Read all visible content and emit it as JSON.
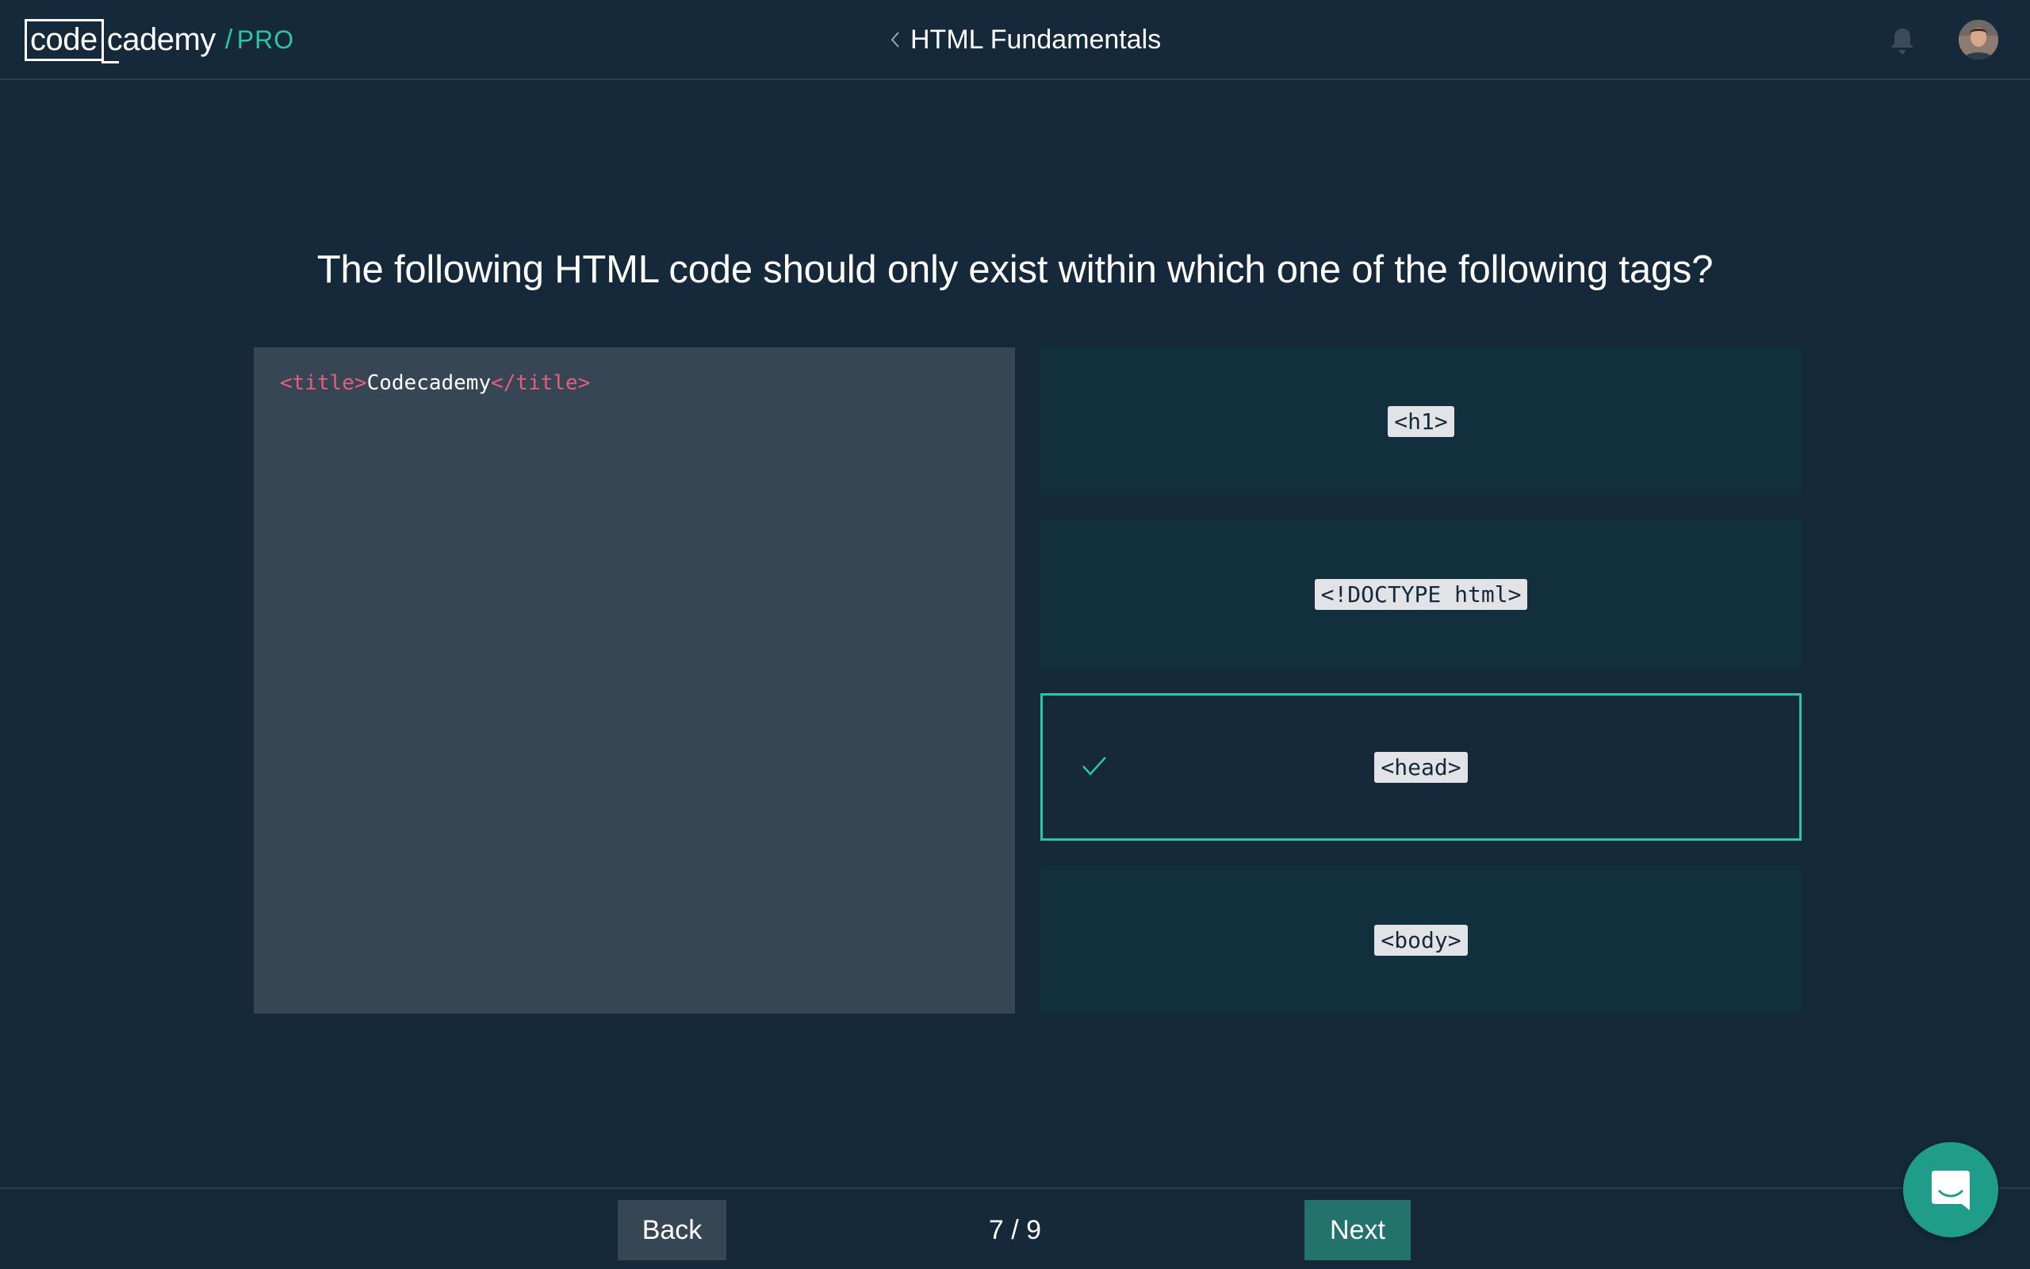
{
  "brand": {
    "logo_boxed": "code",
    "logo_rest": "cademy",
    "separator": "/",
    "tier": "PRO"
  },
  "header": {
    "course_title": "HTML Fundamentals",
    "back_icon": "chevron-left-icon",
    "notification_icon": "bell-icon",
    "avatar": "user-avatar"
  },
  "quiz": {
    "question": "The following HTML code should only exist within which one of the following tags?",
    "code": {
      "open_tag": "<title>",
      "content": "Codecademy",
      "close_tag": "</title>"
    },
    "answers": [
      {
        "label": "<h1>",
        "selected": false
      },
      {
        "label": "<!DOCTYPE html>",
        "selected": false
      },
      {
        "label": "<head>",
        "selected": true,
        "status_icon": "check-icon"
      },
      {
        "label": "<body>",
        "selected": false
      }
    ]
  },
  "footer": {
    "back_label": "Back",
    "progress": "7 / 9",
    "next_label": "Next"
  },
  "chat": {
    "icon": "chat-icon"
  },
  "colors": {
    "background": "#15293a",
    "accent": "#2ec4aa",
    "code_panel": "#364654",
    "answer_panel": "#122f3e",
    "next_button": "#23736c",
    "tag_color": "#e85d7c"
  }
}
